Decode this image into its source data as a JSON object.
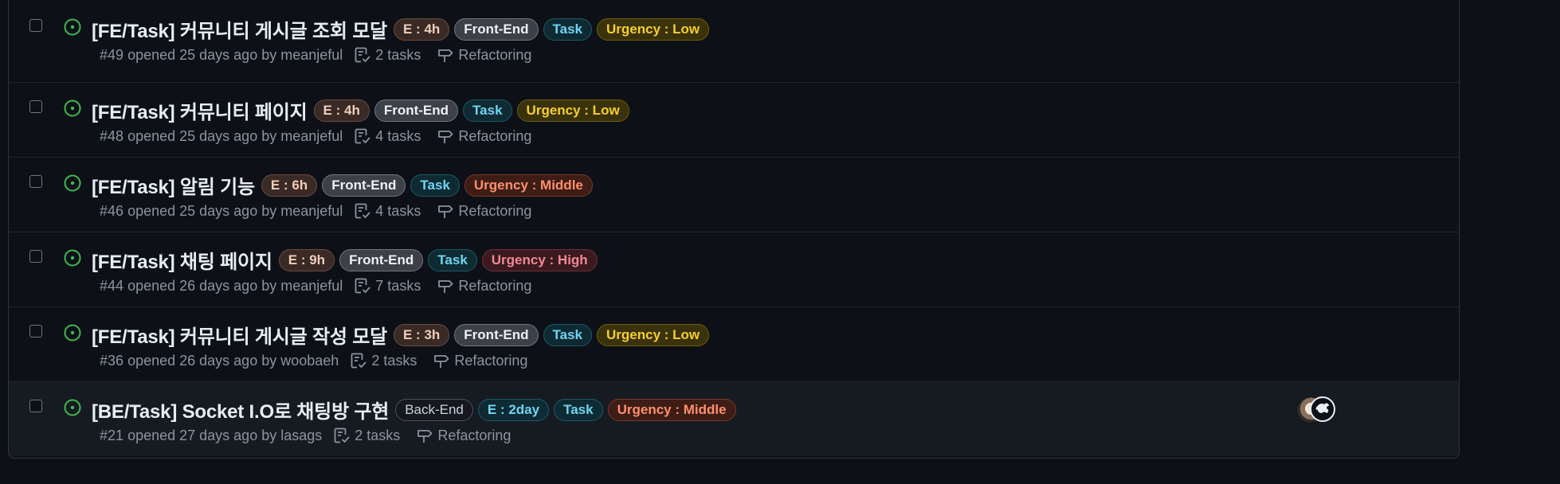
{
  "issues": [
    {
      "title": "[FE/Task] 커뮤니티 게시글 조회 모달",
      "labels": [
        {
          "text": "E : 4h",
          "kind": "est"
        },
        {
          "text": "Front-End",
          "kind": "fe"
        },
        {
          "text": "Task",
          "kind": "task"
        },
        {
          "text": "Urgency : Low",
          "kind": "low"
        }
      ],
      "number": "#49",
      "opened": "opened 25 days ago by",
      "author": "meanjeful",
      "tasks": "2 tasks",
      "milestone": "Refactoring"
    },
    {
      "title": "[FE/Task] 커뮤니티 페이지",
      "labels": [
        {
          "text": "E : 4h",
          "kind": "est"
        },
        {
          "text": "Front-End",
          "kind": "fe"
        },
        {
          "text": "Task",
          "kind": "task"
        },
        {
          "text": "Urgency : Low",
          "kind": "low"
        }
      ],
      "number": "#48",
      "opened": "opened 25 days ago by",
      "author": "meanjeful",
      "tasks": "4 tasks",
      "milestone": "Refactoring"
    },
    {
      "title": "[FE/Task] 알림 기능",
      "labels": [
        {
          "text": "E : 6h",
          "kind": "est"
        },
        {
          "text": "Front-End",
          "kind": "fe"
        },
        {
          "text": "Task",
          "kind": "task"
        },
        {
          "text": "Urgency : Middle",
          "kind": "mid"
        }
      ],
      "number": "#46",
      "opened": "opened 25 days ago by",
      "author": "meanjeful",
      "tasks": "4 tasks",
      "milestone": "Refactoring"
    },
    {
      "title": "[FE/Task] 채팅 페이지",
      "labels": [
        {
          "text": "E : 9h",
          "kind": "est"
        },
        {
          "text": "Front-End",
          "kind": "fe"
        },
        {
          "text": "Task",
          "kind": "task"
        },
        {
          "text": "Urgency : High",
          "kind": "high"
        }
      ],
      "number": "#44",
      "opened": "opened 26 days ago by",
      "author": "meanjeful",
      "tasks": "7 tasks",
      "milestone": "Refactoring"
    },
    {
      "title": "[FE/Task] 커뮤니티 게시글 작성 모달",
      "labels": [
        {
          "text": "E : 3h",
          "kind": "est"
        },
        {
          "text": "Front-End",
          "kind": "fe"
        },
        {
          "text": "Task",
          "kind": "task"
        },
        {
          "text": "Urgency : Low",
          "kind": "low"
        }
      ],
      "number": "#36",
      "opened": "opened 26 days ago by",
      "author": "woobaeh",
      "tasks": "2 tasks",
      "milestone": "Refactoring"
    },
    {
      "title": "[BE/Task] Socket I.O로 채팅방 구현",
      "labels": [
        {
          "text": "Back-End",
          "kind": "be"
        },
        {
          "text": "E : 2day",
          "kind": "day"
        },
        {
          "text": "Task",
          "kind": "task"
        },
        {
          "text": "Urgency : Middle",
          "kind": "mid"
        }
      ],
      "number": "#21",
      "opened": "opened 27 days ago by",
      "author": "lasags",
      "tasks": "2 tasks",
      "milestone": "Refactoring",
      "assignee_avatars": [
        "avatar",
        "avatar"
      ]
    }
  ],
  "colors": {
    "open_icon": "#3fb950",
    "background": "#0d1117",
    "muted_text": "#8b949e"
  }
}
